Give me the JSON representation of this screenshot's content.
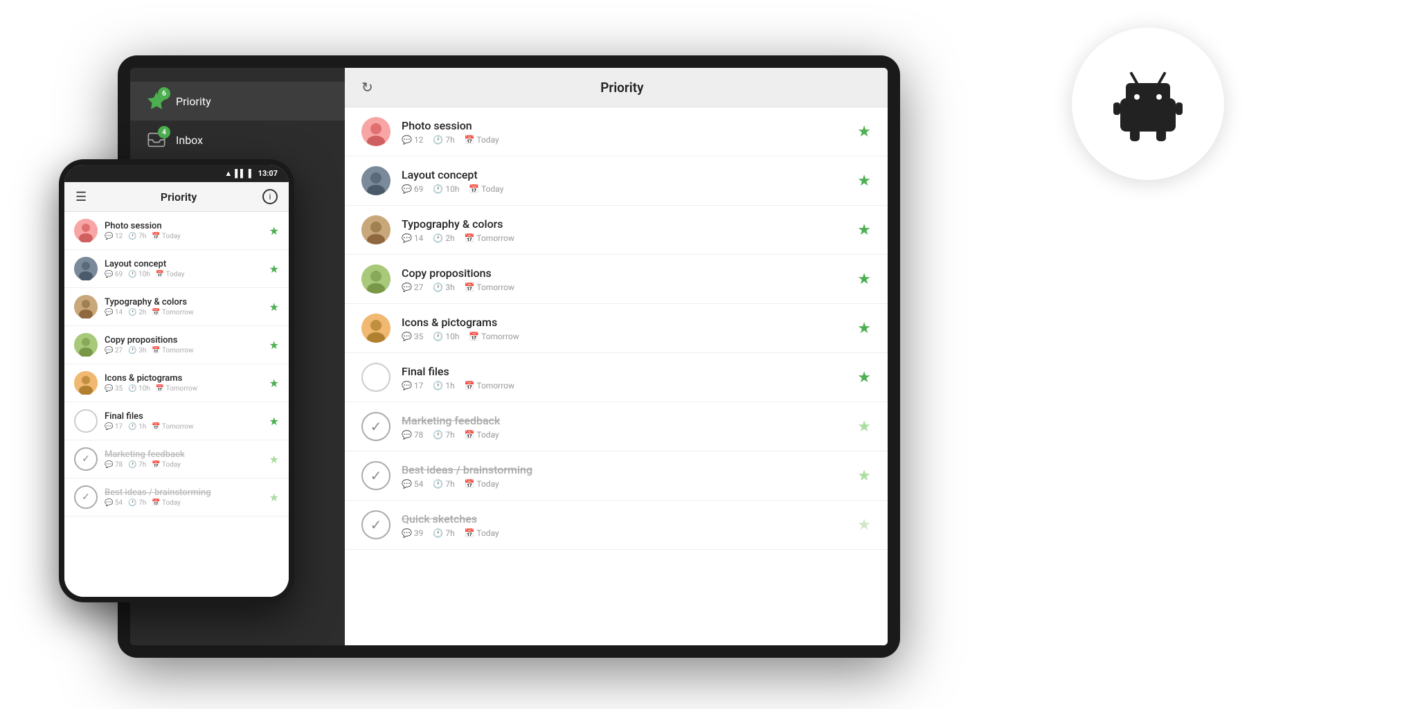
{
  "tablet": {
    "sidebar": {
      "items": [
        {
          "id": "priority",
          "label": "Priority",
          "badge": "6",
          "active": true
        },
        {
          "id": "inbox",
          "label": "Inbox",
          "badge": "4",
          "active": false
        }
      ]
    },
    "header": {
      "title": "Priority"
    },
    "tasks": [
      {
        "id": 1,
        "title": "Photo session",
        "comments": "12",
        "time": "7h",
        "date": "Today",
        "starred": true,
        "done": false,
        "avatarType": "photo",
        "avatarColor": "av-pink"
      },
      {
        "id": 2,
        "title": "Layout concept",
        "comments": "69",
        "time": "10h",
        "date": "Today",
        "starred": true,
        "done": false,
        "avatarType": "photo",
        "avatarColor": "av-dark"
      },
      {
        "id": 3,
        "title": "Typography & colors",
        "comments": "14",
        "time": "2h",
        "date": "Tomorrow",
        "starred": true,
        "done": false,
        "avatarType": "photo",
        "avatarColor": "av-brown"
      },
      {
        "id": 4,
        "title": "Copy propositions",
        "comments": "27",
        "time": "3h",
        "date": "Tomorrow",
        "starred": true,
        "done": false,
        "avatarType": "photo",
        "avatarColor": "av-green"
      },
      {
        "id": 5,
        "title": "Icons & pictograms",
        "comments": "35",
        "time": "10h",
        "date": "Tomorrow",
        "starred": true,
        "done": false,
        "avatarType": "photo",
        "avatarColor": "av-orange"
      },
      {
        "id": 6,
        "title": "Final files",
        "comments": "17",
        "time": "1h",
        "date": "Tomorrow",
        "starred": true,
        "done": false,
        "avatarType": "empty",
        "avatarColor": ""
      },
      {
        "id": 7,
        "title": "Marketing feedback",
        "comments": "78",
        "time": "7h",
        "date": "Today",
        "starred": true,
        "done": true,
        "avatarType": "check",
        "avatarColor": ""
      },
      {
        "id": 8,
        "title": "Best ideas / brainstorming",
        "comments": "54",
        "time": "7h",
        "date": "Today",
        "starred": true,
        "done": true,
        "avatarType": "check",
        "avatarColor": ""
      },
      {
        "id": 9,
        "title": "Quick sketches",
        "comments": "39",
        "time": "7h",
        "date": "Today",
        "starred": true,
        "done": true,
        "avatarType": "check",
        "avatarColor": ""
      }
    ]
  },
  "phone": {
    "statusBar": {
      "time": "13:07",
      "signal": "▂▄▆",
      "wifi": "WiFi",
      "battery": "▌"
    },
    "header": {
      "title": "Priority",
      "menuIcon": "☰",
      "infoIcon": "i"
    },
    "tasks": [
      {
        "id": 1,
        "title": "Photo session",
        "comments": "12",
        "time": "7h",
        "date": "Today",
        "starred": "active",
        "done": false,
        "avatarType": "photo",
        "avatarColor": "av-pink"
      },
      {
        "id": 2,
        "title": "Layout concept",
        "comments": "69",
        "time": "10h",
        "date": "Today",
        "starred": "active",
        "done": false,
        "avatarType": "photo",
        "avatarColor": "av-dark"
      },
      {
        "id": 3,
        "title": "Typography & colors",
        "comments": "14",
        "time": "2h",
        "date": "Tomorrow",
        "starred": "active",
        "done": false,
        "avatarType": "photo",
        "avatarColor": "av-brown"
      },
      {
        "id": 4,
        "title": "Copy propositions",
        "comments": "27",
        "time": "3h",
        "date": "Tomorrow",
        "starred": "active",
        "done": false,
        "avatarType": "photo",
        "avatarColor": "av-green"
      },
      {
        "id": 5,
        "title": "Icons & pictograms",
        "comments": "35",
        "time": "10h",
        "date": "Tomorrow",
        "starred": "active",
        "done": false,
        "avatarType": "photo",
        "avatarColor": "av-orange"
      },
      {
        "id": 6,
        "title": "Final files",
        "comments": "17",
        "time": "1h",
        "date": "Tomorrow",
        "starred": "active",
        "done": false,
        "avatarType": "empty",
        "avatarColor": ""
      },
      {
        "id": 7,
        "title": "Marketing feedback",
        "comments": "78",
        "time": "7h",
        "date": "Today",
        "starred": "muted",
        "done": true,
        "avatarType": "check",
        "avatarColor": ""
      },
      {
        "id": 8,
        "title": "Best ideas / brainstorming",
        "comments": "54",
        "time": "7h",
        "date": "Today",
        "starred": "muted",
        "done": true,
        "avatarType": "check",
        "avatarColor": ""
      }
    ]
  },
  "android": {
    "circleLabel": "Android"
  },
  "icons": {
    "star": "★",
    "refresh": "↻",
    "comment": "💬",
    "clock": "🕐",
    "calendar": "📅",
    "check": "✓",
    "menu": "☰",
    "info": "i"
  }
}
